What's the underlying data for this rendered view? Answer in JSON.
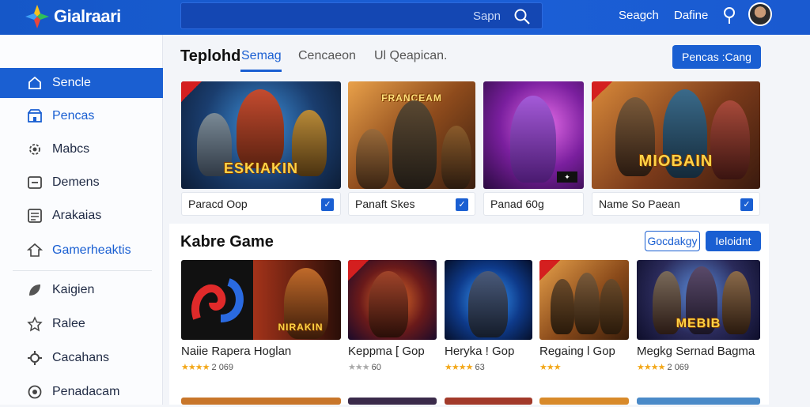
{
  "header": {
    "logo_text": "Gialraari",
    "search_placeholder": "Sapn",
    "link_1": "Seagch",
    "link_2": "Dafine"
  },
  "sidebar": {
    "items": [
      {
        "label": "Sencle",
        "icon": "home-icon"
      },
      {
        "label": "Pencas",
        "icon": "store-icon"
      },
      {
        "label": "Mabcs",
        "icon": "settings-icon"
      },
      {
        "label": "Demens",
        "icon": "window-icon"
      },
      {
        "label": "Arakaias",
        "icon": "list-icon"
      },
      {
        "label": "Gamerheaktis",
        "icon": "house-outline-icon"
      },
      {
        "label": "Kaigien",
        "icon": "leaf-icon"
      },
      {
        "label": "Ralee",
        "icon": "star-icon"
      },
      {
        "label": "Cacahans",
        "icon": "gear-icon"
      },
      {
        "label": "Penadacam",
        "icon": "badge-icon"
      }
    ]
  },
  "tabs": {
    "title": "Teplohd",
    "items": [
      "Semag",
      "Cencaeon",
      "Ul Qeapican."
    ],
    "action_button": "Pencas :Cang"
  },
  "featured": [
    {
      "label": "Paracd Oop",
      "banner": "ESKIAKIN"
    },
    {
      "label": "Panaft Skes",
      "banner": "FRANCEAM"
    },
    {
      "label": "Panad 60g",
      "banner": ""
    },
    {
      "label": "Name So Paean",
      "banner": "MIOBAIN"
    }
  ],
  "section": {
    "title": "Kabre Game",
    "outline_button": "Gocdakgy",
    "primary_button": "Ieloidnt"
  },
  "games": [
    {
      "title": "Naiie Rapera Hoglan",
      "stars": "★★★★",
      "rating": "2 069",
      "banner": "NIRAKIN"
    },
    {
      "title": "Keppma [ Gop",
      "stars": "★★★",
      "rating": "60",
      "banner": ""
    },
    {
      "title": "Heryka ! Gop",
      "stars": "★★★★",
      "rating": "63",
      "banner": ""
    },
    {
      "title": "Regaing l Gop",
      "stars": "★★★",
      "rating": "",
      "banner": ""
    },
    {
      "title": "Megkg Sernad Bagma",
      "stars": "★★★★",
      "rating": "2 069",
      "banner": "MEBIB"
    }
  ],
  "colors": {
    "accent": "#1a5fd2",
    "topbar": "#1557c8",
    "star": "#f3a81a"
  }
}
